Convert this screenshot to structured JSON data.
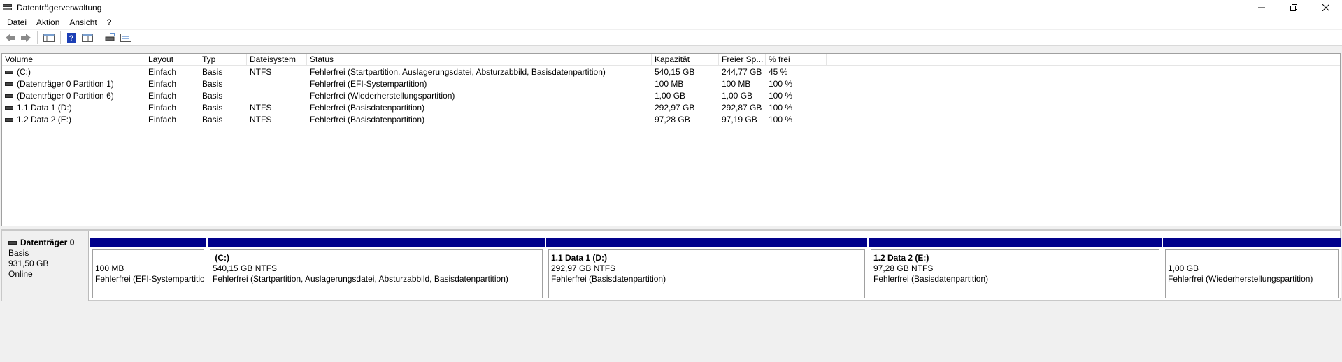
{
  "window": {
    "title": "Datenträgerverwaltung",
    "controls": [
      "minimize",
      "restore",
      "close"
    ]
  },
  "menu": {
    "items": [
      {
        "label": "Datei"
      },
      {
        "label": "Aktion"
      },
      {
        "label": "Ansicht"
      },
      {
        "label": "?"
      }
    ]
  },
  "toolbar": {
    "buttons": [
      "back-arrow-icon",
      "forward-arrow-icon",
      "show-hide-console-tree-icon",
      "help-icon",
      "properties-icon",
      "rescan-icon",
      "detail-view-icon"
    ]
  },
  "volume_list": {
    "columns": [
      "Volume",
      "Layout",
      "Typ",
      "Dateisystem",
      "Status",
      "Kapazität",
      "Freier Sp...",
      "% frei"
    ],
    "rows": [
      {
        "volume": " (C:)",
        "layout": "Einfach",
        "typ": "Basis",
        "fs": "NTFS",
        "status": "Fehlerfrei (Startpartition, Auslagerungsdatei, Absturzabbild, Basisdatenpartition)",
        "capacity": "540,15 GB",
        "free": "244,77 GB",
        "pct": "45 %"
      },
      {
        "volume": "(Datenträger 0 Partition 1)",
        "layout": "Einfach",
        "typ": "Basis",
        "fs": "",
        "status": "Fehlerfrei (EFI-Systempartition)",
        "capacity": "100 MB",
        "free": "100 MB",
        "pct": "100 %"
      },
      {
        "volume": "(Datenträger 0 Partition 6)",
        "layout": "Einfach",
        "typ": "Basis",
        "fs": "",
        "status": "Fehlerfrei (Wiederherstellungspartition)",
        "capacity": "1,00 GB",
        "free": "1,00 GB",
        "pct": "100 %"
      },
      {
        "volume": "1.1 Data 1 (D:)",
        "layout": "Einfach",
        "typ": "Basis",
        "fs": "NTFS",
        "status": "Fehlerfrei (Basisdatenpartition)",
        "capacity": "292,97 GB",
        "free": "292,87 GB",
        "pct": "100 %"
      },
      {
        "volume": "1.2 Data 2 (E:)",
        "layout": "Einfach",
        "typ": "Basis",
        "fs": "NTFS",
        "status": "Fehlerfrei (Basisdatenpartition)",
        "capacity": "97,28 GB",
        "free": "97,19 GB",
        "pct": "100 %"
      }
    ]
  },
  "disk": {
    "name": "Datenträger 0",
    "type": "Basis",
    "size": "931,50 GB",
    "state": "Online",
    "partitions": [
      {
        "name": "",
        "size": "100 MB",
        "status": "Fehlerfrei (EFI-Systempartitio"
      },
      {
        "name": "(C:)",
        "size": "540,15 GB NTFS",
        "status": "Fehlerfrei (Startpartition, Auslagerungsdatei, Absturzabbild, Basisdatenpartition)"
      },
      {
        "name": "1.1 Data 1  (D:)",
        "size": "292,97 GB NTFS",
        "status": "Fehlerfrei (Basisdatenpartition)"
      },
      {
        "name": "1.2 Data 2  (E:)",
        "size": "97,28 GB NTFS",
        "status": "Fehlerfrei (Basisdatenpartition)"
      },
      {
        "name": "",
        "size": "1,00 GB",
        "status": "Fehlerfrei (Wiederherstellungspartition)"
      }
    ]
  },
  "colors": {
    "partition_bar": "#00008b",
    "background": "#f0f0f0"
  }
}
